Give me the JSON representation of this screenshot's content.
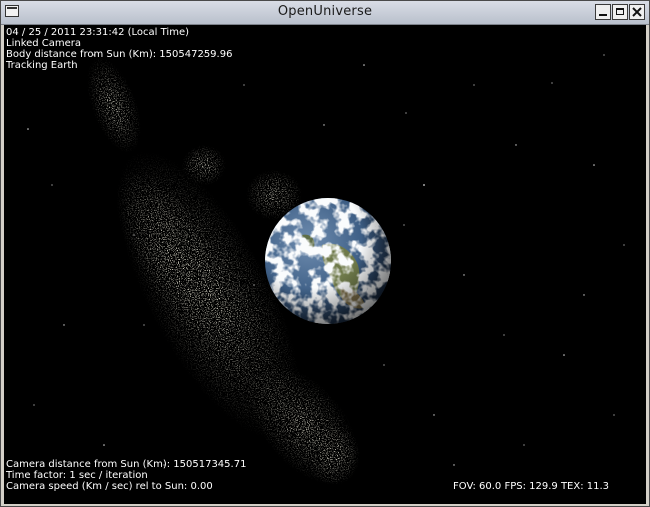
{
  "window": {
    "title": "OpenUniverse"
  },
  "hud": {
    "datetime": "04 / 25 / 2011  23:31:42 (Local Time)",
    "camera_mode": "Linked Camera",
    "body_distance": "Body distance from Sun (Km): 150547259.96",
    "tracking": "Tracking Earth",
    "camera_distance": "Camera distance from Sun (Km): 150517345.71",
    "time_factor": "Time factor: 1 sec / iteration",
    "camera_speed": "Camera speed (Km / sec) rel to Sun: 0.00",
    "stats": "FOV: 60.0   FPS: 129.9  TEX: 11.3"
  },
  "colors": {
    "space": "#000000",
    "text": "#ffffff",
    "milkyway": "#b8b49a",
    "ocean": "#3e5f86",
    "cloud": "#f2f4f6"
  }
}
